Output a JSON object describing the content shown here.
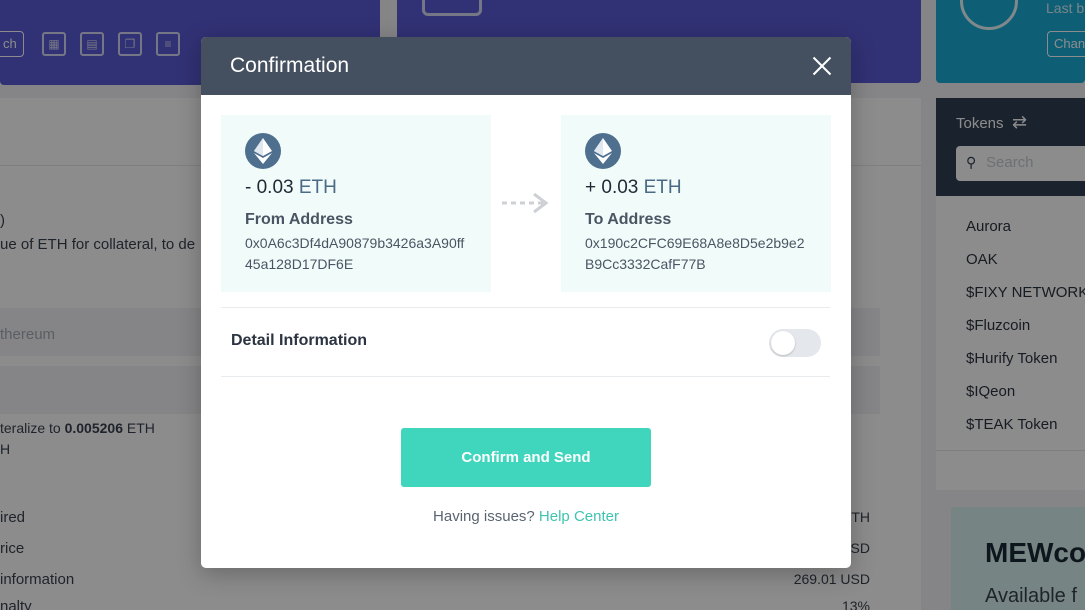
{
  "background": {
    "search_button_label": "ch",
    "blue_card": {
      "title": "Last b",
      "button_label": "Chan"
    },
    "main": {
      "fragment_paren": ")",
      "description": "ue of ETH for collateral, to de",
      "network_placeholder": "thereum",
      "collateralize_prefix": "teralize to ",
      "collateralize_amount": "0.005206",
      "collateralize_unit": " ETH",
      "collateralize_line2": "H",
      "rows": [
        {
          "label": "ired",
          "value": "TH"
        },
        {
          "label": "rice",
          "value": "SD"
        },
        {
          "label": " information",
          "value": "269.01 USD"
        },
        {
          "label": "nalty",
          "value": "13%"
        }
      ]
    },
    "tokens": {
      "title": "Tokens",
      "search_placeholder": "Search",
      "items": [
        "Aurora",
        "OAK",
        "$FIXY NETWORK",
        "$Fluzcoin",
        "$Hurify Token",
        "$IQeon",
        "$TEAK Token"
      ]
    },
    "mew_card": {
      "title": "MEWco",
      "subtitle": "Available f"
    }
  },
  "modal": {
    "title": "Confirmation",
    "from": {
      "sign": "- ",
      "amount": "0.03",
      "unit": " ETH",
      "label": "From Address",
      "address": "0x0A6c3Df4dA90879b3426a3A90ff45a128D17DF6E"
    },
    "to": {
      "sign": "+ ",
      "amount": "0.03",
      "unit": " ETH",
      "label": "To Address",
      "address": "0x190c2CFC69E68A8e8D5e2b9e2B9Cc3332CafF77B"
    },
    "detail_label": "Detail Information",
    "detail_toggle_on": false,
    "confirm_label": "Confirm and Send",
    "help_prefix": "Having issues? ",
    "help_link": "Help Center"
  },
  "colors": {
    "header_bg": "#44505f",
    "accent_teal": "#3fd6bd",
    "address_box_bg": "#f1fbfa",
    "eth_circle": "#4f6f8f",
    "purple_card": "#5a5ad6",
    "blue_card": "#1aaed8"
  }
}
